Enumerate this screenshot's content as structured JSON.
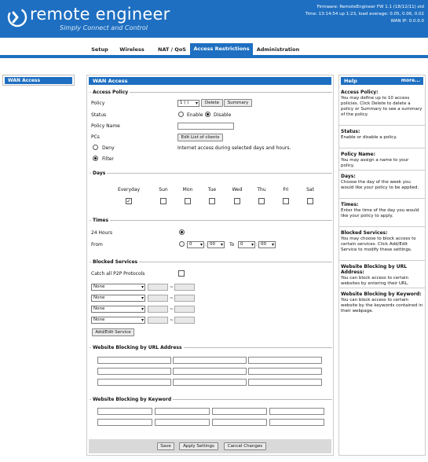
{
  "header": {
    "brand": "remote engineer",
    "tagline": "Simply Connect and Control",
    "firmware": "Firmware: RemoteEngineer FW 1.1 (18/12/11) std",
    "time": "Time: 13:14:54 up 1:23, load average: 0.05, 0.06, 0.02",
    "wan_ip": "WAN IP: 0.0.0.0"
  },
  "nav": {
    "tabs": [
      "Setup",
      "Wireless",
      "NAT / QoS",
      "Access Restrictions",
      "Administration"
    ],
    "active": "Access Restrictions"
  },
  "leftmenu": {
    "item": "WAN Access"
  },
  "main": {
    "title": "WAN Access",
    "access_policy": {
      "legend": "Access Policy",
      "policy_label": "Policy",
      "policy_value": "1 ( )",
      "delete_btn": "Delete",
      "summary_btn": "Summary",
      "status_label": "Status",
      "enable_label": "Enable",
      "disable_label": "Disable",
      "status": "disable",
      "policy_name_label": "Policy Name",
      "policy_name_value": "",
      "pcs_label": "PCs",
      "edit_list_btn": "Edit List of clients",
      "deny_label": "Deny",
      "filter_label": "Filter",
      "mode": "filter",
      "internet_text": "Internet access during selected days and hours."
    },
    "days": {
      "legend": "Days",
      "labels": [
        "Everyday",
        "Sun",
        "Mon",
        "Tue",
        "Wed",
        "Thu",
        "Fri",
        "Sat"
      ],
      "checked": [
        true,
        false,
        false,
        false,
        false,
        false,
        false,
        false
      ]
    },
    "times": {
      "legend": "Times",
      "hours24_label": "24 Hours",
      "from_label": "From",
      "to_label": "To",
      "mode": "24hours",
      "from_hour": "0",
      "from_min": "00",
      "to_hour": "0",
      "to_min": "00"
    },
    "blocked": {
      "legend": "Blocked Services",
      "p2p_label": "Catch all P2P Protocols",
      "p2p_checked": false,
      "services": [
        "None",
        "None",
        "None",
        "None"
      ],
      "range_sep": "~",
      "add_btn": "Add/Edit Service"
    },
    "url_block": {
      "legend": "Website Blocking by URL Address"
    },
    "keyword_block": {
      "legend": "Website Blocking by Keyword"
    },
    "footer": {
      "save": "Save",
      "apply": "Apply Settings",
      "cancel": "Cancel Changes"
    }
  },
  "help": {
    "title": "Help",
    "more": "more...",
    "blocks": [
      {
        "title": "Access Policy:",
        "text": "You may define up to 10 access policies. Click Delete to delete a policy or Summary to see a summary of the policy."
      },
      {
        "title": "Status:",
        "text": "Enable or disable a policy."
      },
      {
        "title": "Policy Name:",
        "text": "You may assign a name to your policy."
      },
      {
        "title": "Days:",
        "text": "Choose the day of the week you would like your policy to be applied."
      },
      {
        "title": "Times:",
        "text": "Enter the time of the day you would like your policy to apply."
      },
      {
        "title": "Blocked Services:",
        "text": "You may choose to block access to certain services. Click Add/Edit Service to modify these settings."
      },
      {
        "title": "Website Blocking by URL Address:",
        "text": "You can block access to certain websites by entering their URL."
      },
      {
        "title": "Website Blocking by Keyword:",
        "text": "You can block access to certain website by the keywords contained in their webpage."
      }
    ]
  },
  "colors": {
    "accent": "#1e6fc1"
  }
}
